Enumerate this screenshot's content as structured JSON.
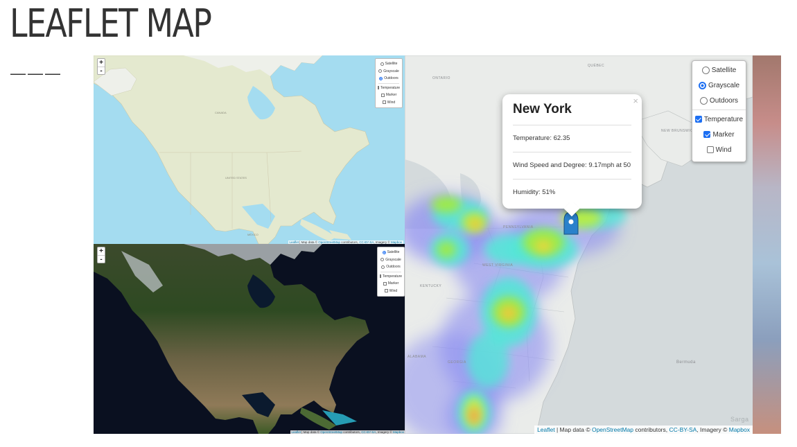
{
  "page": {
    "title": "LEAFLET MAP",
    "dash": "———"
  },
  "zoom": {
    "in": "+",
    "out": "-"
  },
  "layers": {
    "base": [
      "Satellite",
      "Grayscale",
      "Outdoors"
    ],
    "overlays": [
      "Temperature",
      "Marker",
      "Wind"
    ]
  },
  "maps": {
    "outdoors": {
      "selected_base": "Outdoors",
      "overlays_checked": []
    },
    "satellite": {
      "selected_base": "Satellite",
      "overlays_checked": []
    },
    "grayscale": {
      "selected_base": "Grayscale",
      "overlays_checked": [
        "Temperature",
        "Marker"
      ]
    }
  },
  "popup": {
    "city": "New York",
    "temperature": "Temperature: 62.35",
    "wind": "Wind Speed and Degree: 9.17mph at 50",
    "humidity": "Humidity: 51%",
    "close": "×"
  },
  "attribution": {
    "leaflet": "Leaflet",
    "map_data": " | Map data © ",
    "osm": "OpenStreetMap",
    "contributors": " contributors, ",
    "license": "CC-BY-SA",
    "imagery": ", Imagery © ",
    "mapbox": "Mapbox"
  },
  "map_labels": {
    "quebec": "QUÉBEC",
    "ontario": "ONTARIO",
    "new_brunswick": "NEW BRUNSWICK",
    "pennsylvania": "PENNSYLVANIA",
    "west_virginia": "WEST VIRGINIA",
    "kentucky": "KENTUCKY",
    "georgia": "GEORGIA",
    "alabama": "ALABAMA",
    "bermuda": "Bermuda",
    "sargasso": "Sarga"
  },
  "colors": {
    "accent": "#1d6ff2",
    "link": "#0078a8",
    "marker": "#2a81cb"
  }
}
